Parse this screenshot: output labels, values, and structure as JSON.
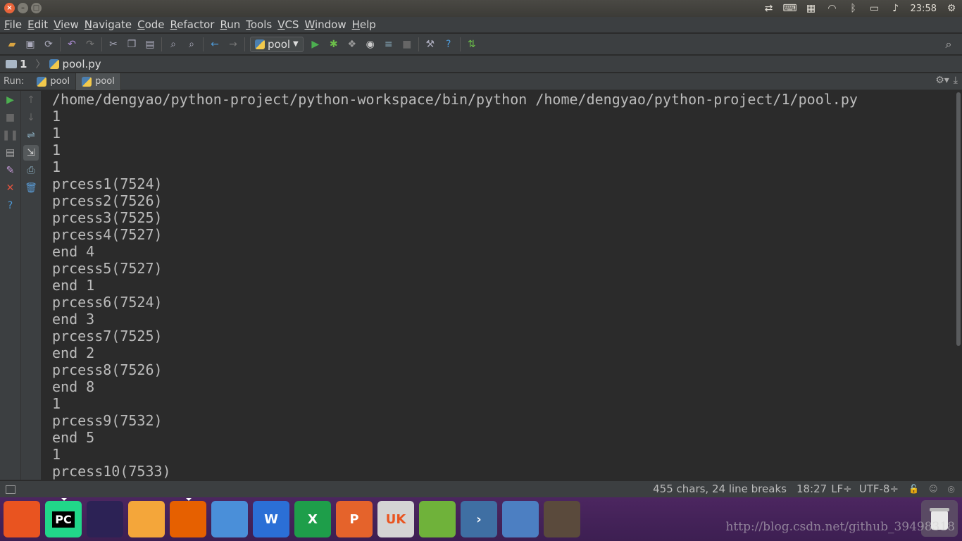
{
  "topbar": {
    "clock": "23:58",
    "tray_icons": [
      "transfer-icon",
      "keyboard-icon",
      "input-method-icon",
      "wifi-icon",
      "bluetooth-icon",
      "battery-icon",
      "volume-icon",
      "power-gear-icon"
    ]
  },
  "menubar": {
    "items": [
      {
        "mnemonic": "F",
        "rest": "ile"
      },
      {
        "mnemonic": "E",
        "rest": "dit"
      },
      {
        "mnemonic": "V",
        "rest": "iew"
      },
      {
        "mnemonic": "N",
        "rest": "avigate"
      },
      {
        "mnemonic": "C",
        "rest": "ode"
      },
      {
        "mnemonic": "R",
        "rest": "efactor"
      },
      {
        "mnemonic": "R",
        "rest": "un"
      },
      {
        "mnemonic": "T",
        "rest": "ools"
      },
      {
        "mnemonic": "V",
        "rest": "CS"
      },
      {
        "mnemonic": "W",
        "rest": "indow"
      },
      {
        "mnemonic": "H",
        "rest": "elp"
      }
    ]
  },
  "toolbar": {
    "run_config": "pool"
  },
  "navbar": {
    "project": "1",
    "file": "pool.py"
  },
  "runbar": {
    "label": "Run:",
    "tabs": [
      "pool",
      "pool"
    ]
  },
  "console": {
    "lines": [
      "/home/dengyao/python-project/python-workspace/bin/python /home/dengyao/python-project/1/pool.py",
      "1",
      "1",
      "1",
      "1",
      "prcess1(7524)",
      "prcess2(7526)",
      "prcess3(7525)",
      "prcess4(7527)",
      "end 4",
      "prcess5(7527)",
      "end 1",
      "prcess6(7524)",
      "end 3",
      "prcess7(7525)",
      "end 2",
      "prcess8(7526)",
      "end 8",
      "1",
      "prcess9(7532)",
      "end 5",
      "1",
      "prcess10(7533)"
    ]
  },
  "statusbar": {
    "chars": "455 chars, 24 line breaks",
    "position": "18:27",
    "line_sep": "LF÷",
    "encoding": "UTF-8÷"
  },
  "dock": {
    "items": [
      {
        "name": "ubuntu-dash",
        "text": "",
        "color": "#e95420"
      },
      {
        "name": "pycharm",
        "text": "PC",
        "color": "#21d789"
      },
      {
        "name": "eclipse",
        "text": "",
        "color": "#2c2255"
      },
      {
        "name": "files",
        "text": "",
        "color": "#f4a63a"
      },
      {
        "name": "firefox",
        "text": "",
        "color": "#e66000"
      },
      {
        "name": "chromium",
        "text": "",
        "color": "#4a8fd9"
      },
      {
        "name": "wps-writer",
        "text": "W",
        "color": "#2b6fd6"
      },
      {
        "name": "wps-spreadsheets",
        "text": "X",
        "color": "#1e9e4a"
      },
      {
        "name": "wps-presentation",
        "text": "P",
        "color": "#e5632b"
      },
      {
        "name": "ubuntu-software",
        "text": "UK",
        "color": "#d4d4d4"
      },
      {
        "name": "software-updater",
        "text": "",
        "color": "#6fb23a"
      },
      {
        "name": "remmina-terminal",
        "text": "›",
        "color": "#3f6fa3"
      },
      {
        "name": "workspace-switcher",
        "text": "",
        "color": "#4c7fc2"
      },
      {
        "name": "gimp",
        "text": "",
        "color": "#5a4a3c"
      }
    ],
    "watermark": "http://blog.csdn.net/github_39498318"
  }
}
